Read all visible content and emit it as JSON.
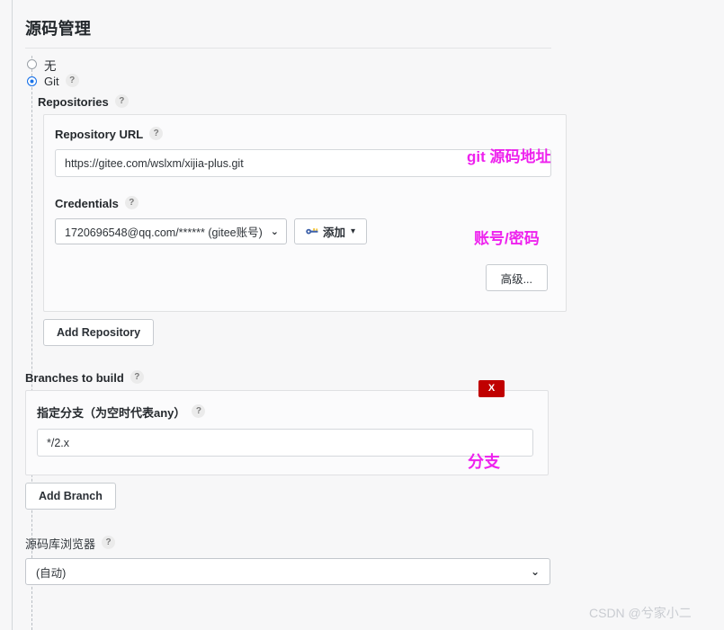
{
  "page": {
    "title": "源码管理"
  },
  "scm_options": [
    {
      "label": "无",
      "selected": false,
      "has_help": false
    },
    {
      "label": "Git",
      "selected": true,
      "has_help": true
    }
  ],
  "help_badge": "?",
  "repositories": {
    "section_label": "Repositories",
    "repository_url": {
      "label": "Repository URL",
      "value": "https://gitee.com/wslxm/xijia-plus.git",
      "placeholder": ""
    },
    "credentials": {
      "label": "Credentials",
      "selected": "1720696548@qq.com/****** (gitee账号)",
      "add_button": "添加",
      "add_button_icon": "key-icon",
      "caret": "▾"
    },
    "advanced_button": "高级...",
    "add_repository_button": "Add Repository"
  },
  "branches": {
    "section_label": "Branches to build",
    "branch_specifier": {
      "label": "指定分支（为空时代表any）",
      "value": "*/2.x",
      "placeholder": ""
    },
    "delete_button": "X",
    "add_branch_button": "Add Branch"
  },
  "repository_browser": {
    "label": "源码库浏览器",
    "selected": "(自动)",
    "caret": "⌄"
  },
  "annotations": {
    "repo_url": "git 源码地址",
    "credentials": "账号/密码",
    "branch": "分支"
  },
  "watermark": "CSDN @兮家小二",
  "colors": {
    "accent": "#1a73e8",
    "annotation": "#ee22ee",
    "danger": "#c00000",
    "background": "#f7f7f8"
  }
}
